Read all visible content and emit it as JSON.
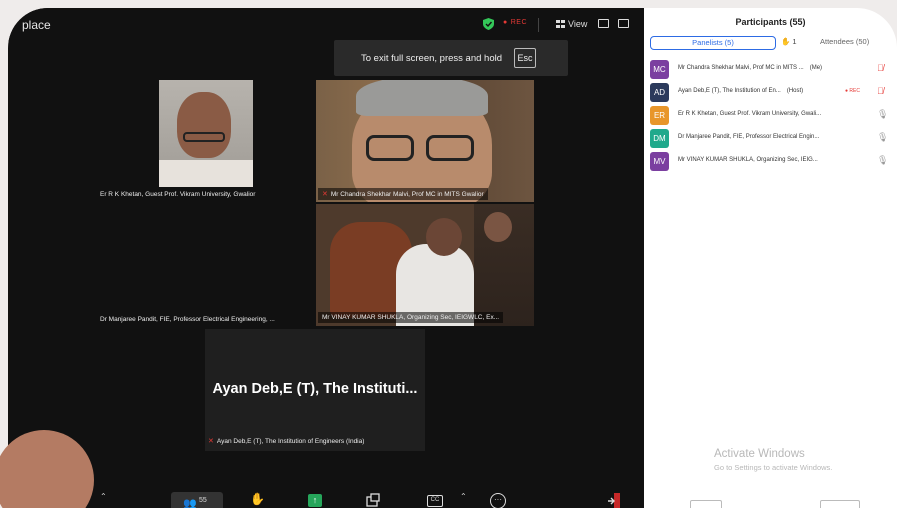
{
  "window": {
    "title": "place",
    "rec": "REC",
    "view_label": "View"
  },
  "fullscreen_toast": {
    "message": "To exit full screen, press and hold",
    "key": "Esc"
  },
  "tiles": {
    "khetan": "Er R K Khetan, Guest Prof. Vikram University, Gwalior",
    "malvi": "Mr Chandra Shekhar Malvi, Prof MC in MITS Gwalior",
    "pandit": "Dr Manjaree Pandit, FIE, Professor Electrical Engineering, ...",
    "shukla": "Mr VINAY KUMAR SHUKLA, Organizing Sec, IEIGWLC, Ex...",
    "ayan_big": "Ayan Deb,E (T), The Instituti...",
    "ayan_label": "Ayan Deb,E (T), The Institution of Engineers (India)"
  },
  "toolbar": {
    "participant_count": "55",
    "cc_label": "CC"
  },
  "panel": {
    "title": "Participants (55)",
    "tabs": {
      "panelists": "Panelists (5)",
      "hand_count": "1",
      "attendees": "Attendees (50)"
    },
    "participants": [
      {
        "initials": "MC",
        "color": "#7b3fa0",
        "name": "Mr Chandra Shekhar Malvi, Prof MC in MITS ...",
        "tag": "(Me)",
        "mic": "muted"
      },
      {
        "initials": "AD",
        "color": "#2b3a5c",
        "name": "Ayan Deb,E (T), The Institution of En...",
        "tag": "(Host)",
        "rec": "REC",
        "mic": "muted"
      },
      {
        "initials": "ER",
        "color": "#e8962a",
        "name": "Er R K Khetan, Guest Prof. Vikram University, Gwali...",
        "mic": "on"
      },
      {
        "initials": "DM",
        "color": "#20a98c",
        "name": "Dr Manjaree Pandit, FIE, Professor Electrical Engin...",
        "mic": "on"
      },
      {
        "initials": "MV",
        "color": "#7b3fa0",
        "name": "Mr VINAY KUMAR SHUKLA, Organizing Sec, IEIG...",
        "mic": "on"
      }
    ],
    "activate_title": "Activate Windows",
    "activate_sub": "Go to Settings to activate Windows."
  }
}
